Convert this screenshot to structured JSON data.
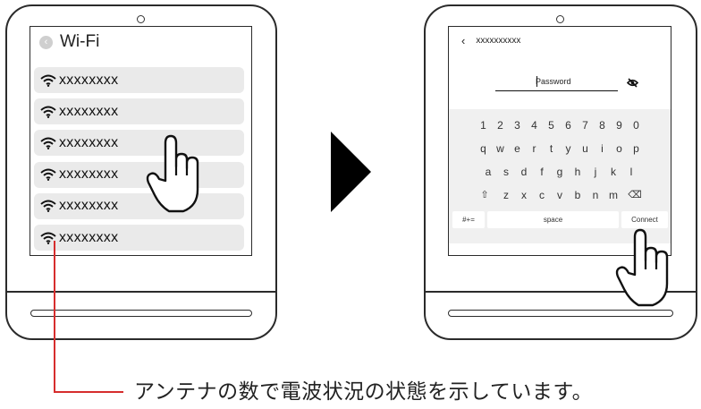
{
  "left_panel": {
    "title": "Wi-Fi",
    "networks": [
      "xxxxxxxx",
      "xxxxxxxx",
      "xxxxxxxx",
      "xxxxxxxx",
      "xxxxxxxx",
      "xxxxxxxx"
    ]
  },
  "right_panel": {
    "ssid": "xxxxxxxxxx",
    "password_placeholder": "Password",
    "keyboard": {
      "row1": [
        "1",
        "2",
        "3",
        "4",
        "5",
        "6",
        "7",
        "8",
        "9",
        "0"
      ],
      "row2": [
        "q",
        "w",
        "e",
        "r",
        "t",
        "y",
        "u",
        "i",
        "o",
        "p"
      ],
      "row3": [
        "a",
        "s",
        "d",
        "f",
        "g",
        "h",
        "j",
        "k",
        "l"
      ],
      "row4": [
        "⇧",
        "z",
        "x",
        "c",
        "v",
        "b",
        "n",
        "m",
        "⌫"
      ],
      "symbols_key": "#+=",
      "space_key": "space",
      "connect_key": "Connect"
    }
  },
  "caption": "アンテナの数で電波状況の状態を示しています。",
  "colors": {
    "accent_leader": "#d62d2d",
    "row_bg": "#eaeaea",
    "keyboard_bg": "#f0f0f0"
  },
  "icons": [
    "wifi-signal-icon",
    "back-icon",
    "hide-password-icon",
    "hand-pointer-icon",
    "arrow-right-icon"
  ]
}
